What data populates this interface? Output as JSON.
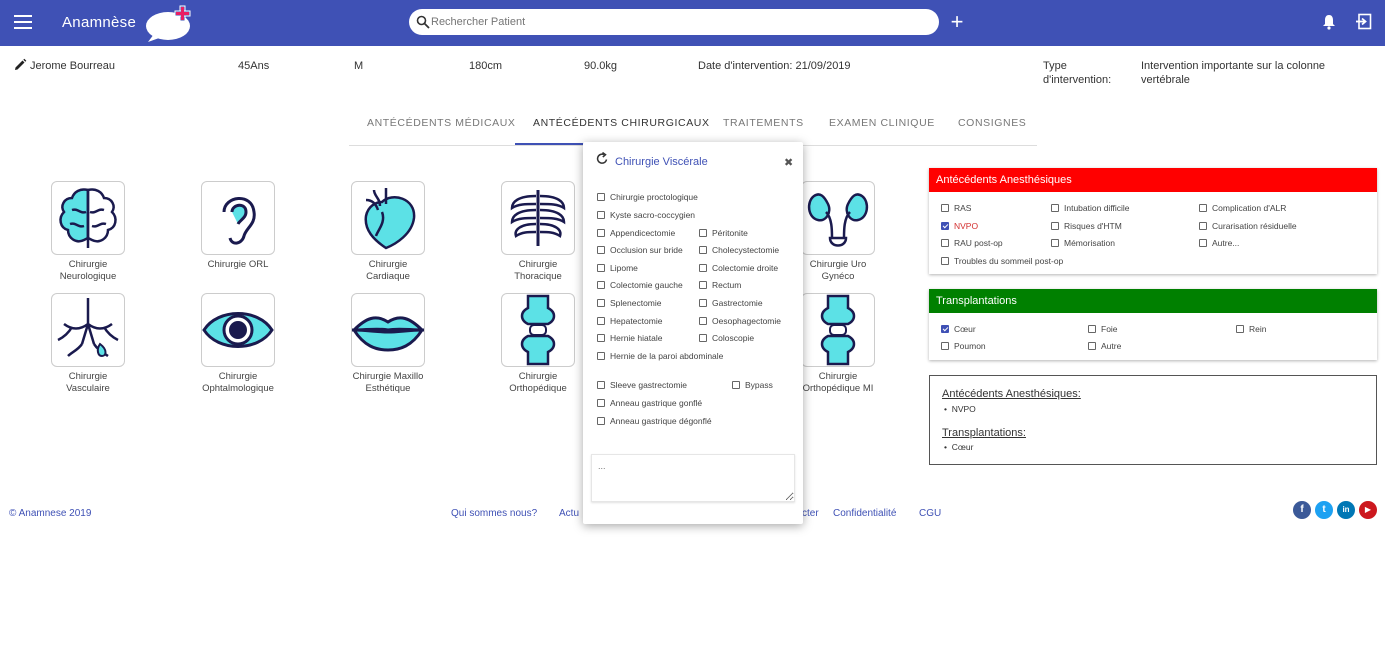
{
  "header": {
    "title": "Anamnèse",
    "search_placeholder": "Rechercher Patient",
    "add_icon": "plus-icon",
    "bell_icon": "bell-icon",
    "exit_icon": "exit-icon"
  },
  "patient": {
    "name": "Jerome Bourreau",
    "age": "45Ans",
    "sex": "M",
    "height": "180cm",
    "weight": "90.0kg",
    "intervention_date": "Date d'intervention: 21/09/2019",
    "type_label_1": "Type",
    "type_label_2": "d'intervention:",
    "type_value_1": "Intervention importante sur la colonne",
    "type_value_2": "vertébrale"
  },
  "tabs": [
    "ANTÉCÉDENTS MÉDICAUX",
    "ANTÉCÉDENTS CHIRURGICAUX",
    "TRAITEMENTS",
    "EXAMEN CLINIQUE",
    "CONSIGNES"
  ],
  "specialties": [
    {
      "l1": "Chirurgie",
      "l2": "Neurologique",
      "icon": "brain-icon"
    },
    {
      "l1": "Chirurgie ORL",
      "l2": "",
      "icon": "ear-icon"
    },
    {
      "l1": "Chirurgie",
      "l2": "Cardiaque",
      "icon": "heart-icon"
    },
    {
      "l1": "Chirurgie",
      "l2": "Thoracique",
      "icon": "ribcage-icon"
    },
    {
      "l1": "Chirurgie Uro",
      "l2": "Gynéco",
      "icon": "kidneys-icon"
    },
    {
      "l1": "Chirurgie",
      "l2": "Vasculaire",
      "icon": "vessels-icon"
    },
    {
      "l1": "Chirurgie",
      "l2": "Ophtalmologique",
      "icon": "eye-icon"
    },
    {
      "l1": "Chirurgie Maxillo",
      "l2": "Esthétique",
      "icon": "lips-icon"
    },
    {
      "l1": "Chirurgie",
      "l2": "Orthopédique",
      "icon": "bone-joint-icon"
    },
    {
      "l1": "Chirurgie",
      "l2": "Orthopédique MI",
      "icon": "bone-joint-icon"
    }
  ],
  "modal": {
    "title": "Chirurgie Viscérale",
    "close": "✖",
    "items": [
      "Chirurgie proctologique",
      "Kyste sacro-coccygien",
      "Appendicectomie",
      "Péritonite",
      "Occlusion sur bride",
      "Cholecystectomie",
      "Lipome",
      "Colectomie droite",
      "Colectomie gauche",
      "Rectum",
      "Splenectomie",
      "Gastrectomie",
      "Hepatectomie",
      "Oesophagectomie",
      "Hernie hiatale",
      "Coloscopie",
      "Hernie de la paroi abdominale",
      "Sleeve gastrectomie",
      "Bypass",
      "Anneau gastrique gonflé",
      "Anneau gastrique dégonflé"
    ],
    "notes_placeholder": "..."
  },
  "anesth": {
    "title": "Antécédents Anesthésiques",
    "color": "#ff0000",
    "items": [
      "RAS",
      "Intubation difficile",
      "Complication d'ALR",
      "NVPO",
      "Risques d'HTM",
      "Curarisation résiduelle",
      "RAU post-op",
      "Mémorisation",
      "Autre...",
      "Troubles du sommeil post-op"
    ],
    "checked": [
      "NVPO"
    ]
  },
  "transplant": {
    "title": "Transplantations",
    "color": "#008000",
    "items": [
      "Cœur",
      "Foie",
      "Rein",
      "Poumon",
      "Autre"
    ],
    "checked": [
      "Cœur"
    ]
  },
  "summary": {
    "anesth_heading": "Antécédents Anesthésiques:",
    "anesth_items": [
      "NVPO"
    ],
    "transplant_heading": "Transplantations:",
    "transplant_items": [
      "Cœur"
    ]
  },
  "footer": {
    "copyright": "© Anamnese 2019",
    "links": [
      "Qui sommes nous?",
      "Actu",
      "cter",
      "Confidentialité",
      "CGU"
    ],
    "social": [
      {
        "icon": "facebook-icon",
        "glyph": "f",
        "color": "#3b5998"
      },
      {
        "icon": "twitter-icon",
        "glyph": "t",
        "color": "#1da1f2"
      },
      {
        "icon": "linkedin-icon",
        "glyph": "in",
        "color": "#0077b5"
      },
      {
        "icon": "youtube-icon",
        "glyph": "▶",
        "color": "#cc181e"
      }
    ]
  }
}
